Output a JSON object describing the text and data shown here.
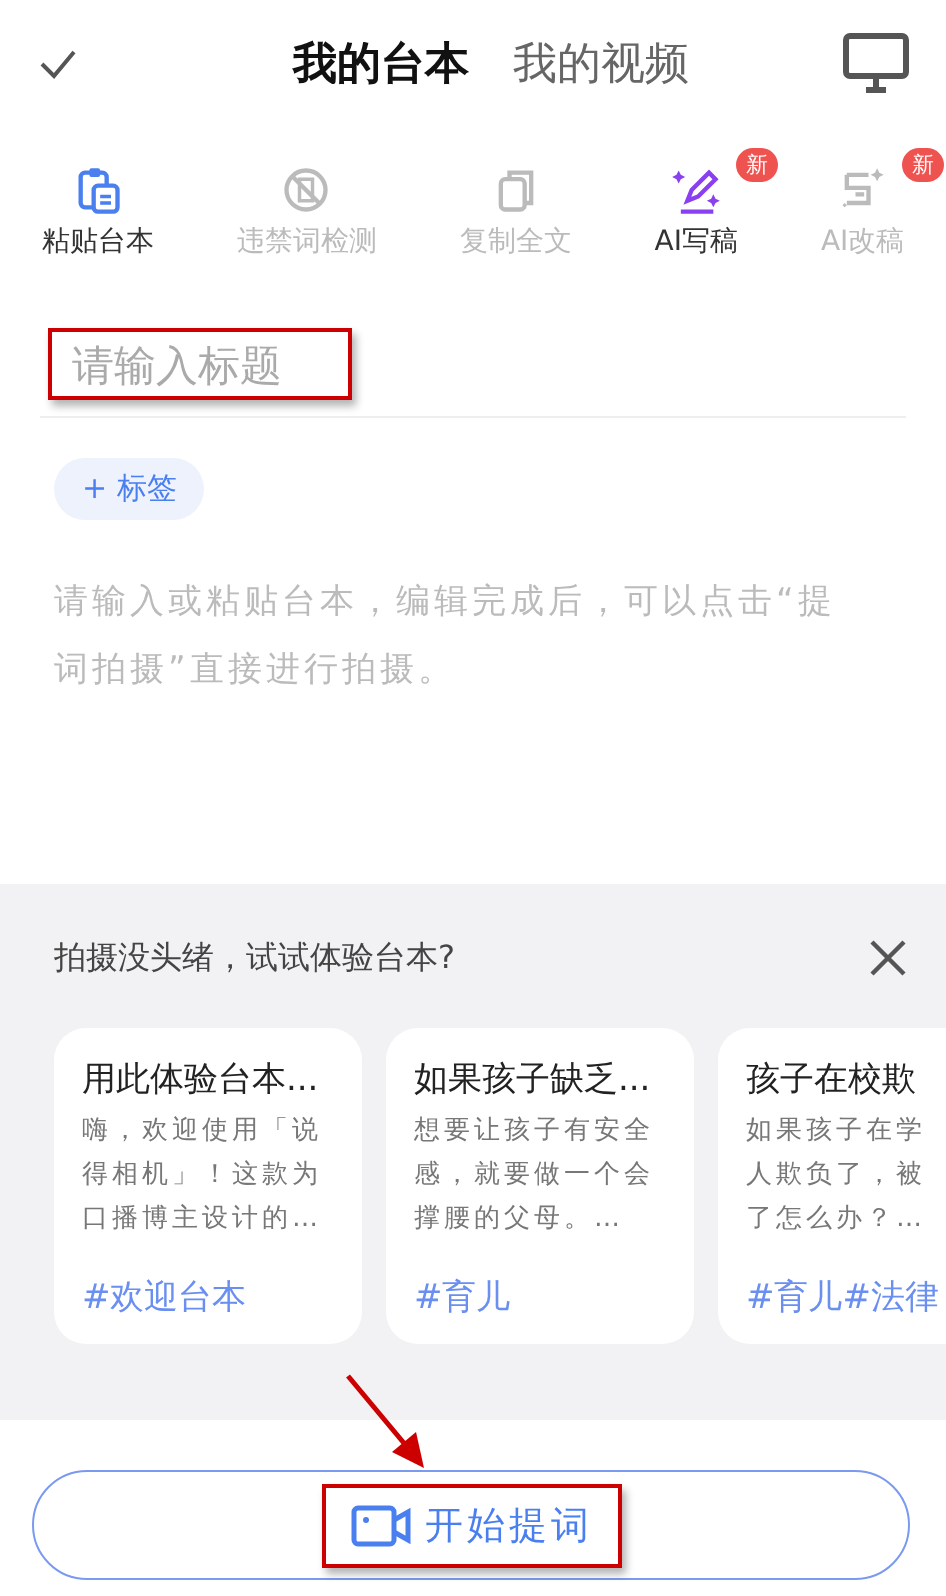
{
  "header": {
    "tabs": [
      {
        "label": "我的台本",
        "selected": true
      },
      {
        "label": "我的视频",
        "selected": false
      }
    ]
  },
  "toolbar": [
    {
      "kind": "paste",
      "label": "粘贴台本",
      "disabled": false
    },
    {
      "kind": "ban",
      "label": "违禁词检测",
      "disabled": true
    },
    {
      "kind": "copy",
      "label": "复制全文",
      "disabled": true
    },
    {
      "kind": "write",
      "label": "AI写稿",
      "disabled": false,
      "badge": "新"
    },
    {
      "kind": "rewrite",
      "label": "AI改稿",
      "disabled": true,
      "badge": "新"
    }
  ],
  "title_field": {
    "placeholder": "请输入标题"
  },
  "tag_button": "+ 标签",
  "body_field": {
    "placeholder": "请输入或粘贴台本，编辑完成后，可以点击“提词拍摄”直接进行拍摄。"
  },
  "samples": {
    "heading": "拍摄没头绪，试试体验台本?",
    "cards": [
      {
        "title": "用此体验台本...",
        "lines": [
          "嗨，欢迎使用「说",
          "得相机」！这款为",
          "口播博主设计的…"
        ],
        "tags": "#欢迎台本"
      },
      {
        "title": "如果孩子缺乏...",
        "lines": [
          "想要让孩子有安全",
          "感，就要做一个会",
          "撑腰的父母。…"
        ],
        "tags": "#育儿"
      },
      {
        "title": "孩子在校欺",
        "lines": [
          "如果孩子在学",
          "人欺负了，被",
          "了怎么办？…"
        ],
        "tags": "#育儿#法律"
      }
    ]
  },
  "start_button": "开始提词"
}
